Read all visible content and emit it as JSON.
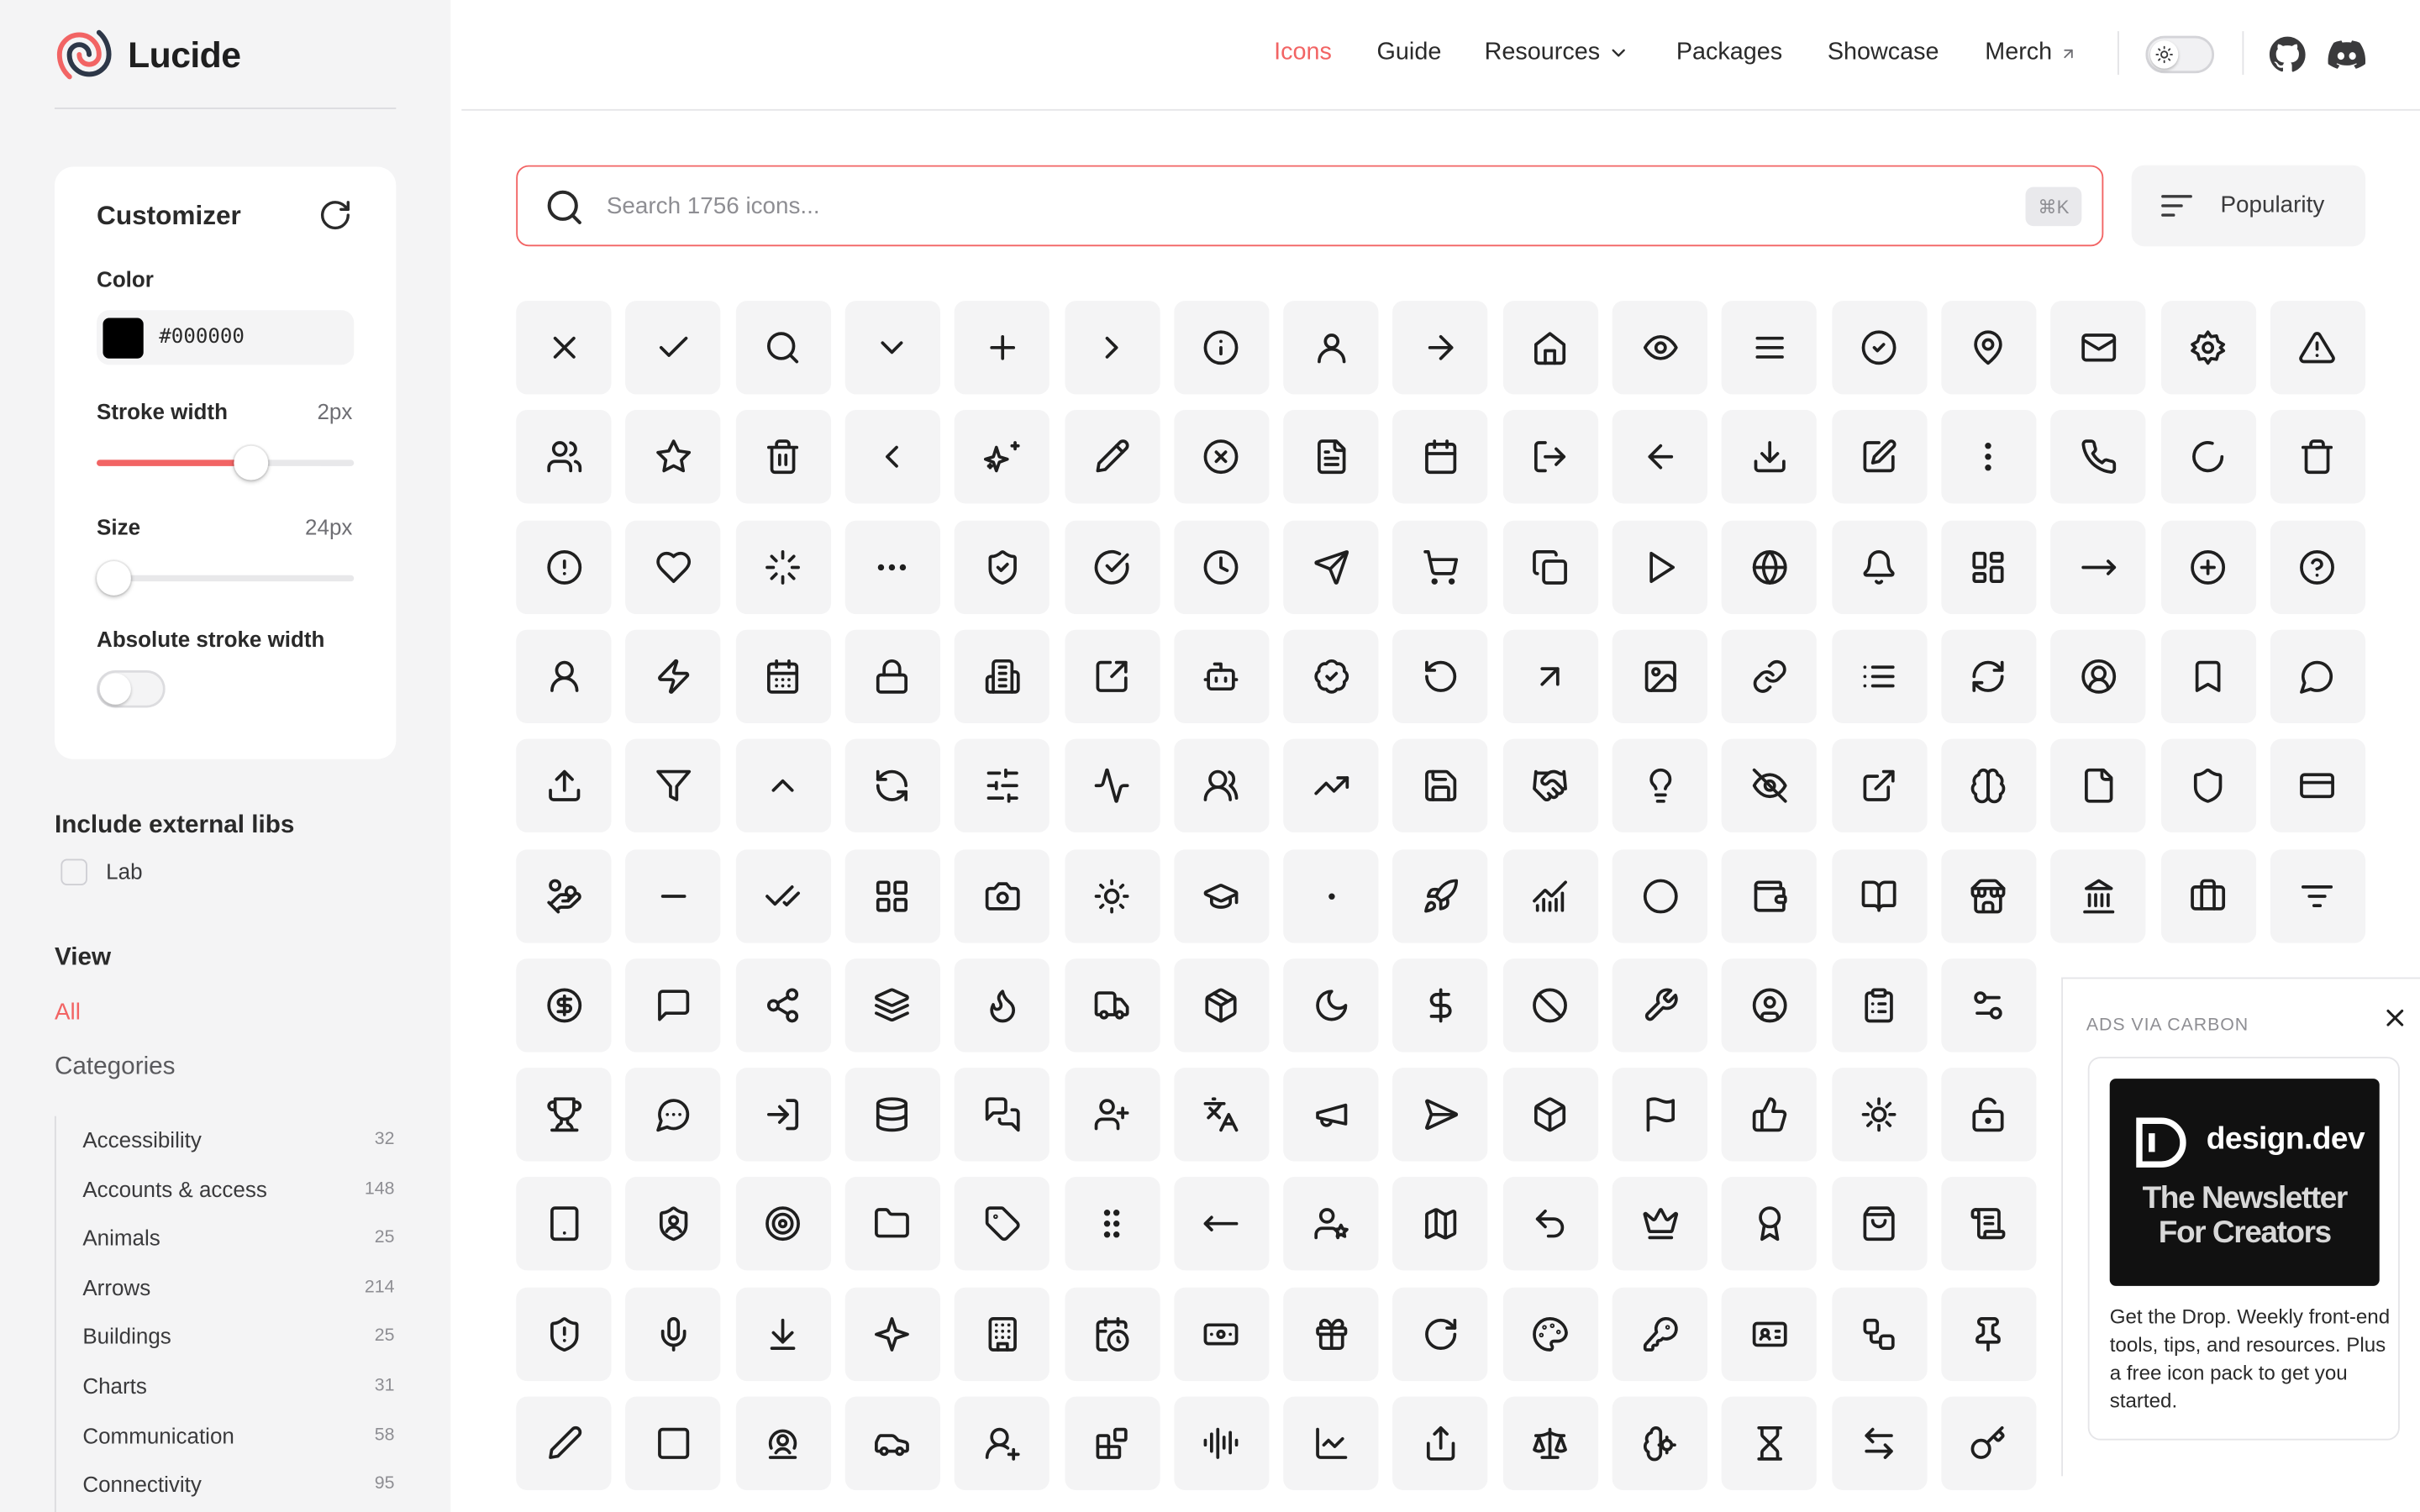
{
  "brand": {
    "name": "Lucide",
    "accent": "#f26464"
  },
  "nav": {
    "items": [
      {
        "label": "Icons",
        "active": true
      },
      {
        "label": "Guide"
      },
      {
        "label": "Resources",
        "dropdown": true
      },
      {
        "label": "Packages"
      },
      {
        "label": "Showcase"
      },
      {
        "label": "Merch",
        "external": true
      }
    ],
    "theme": "light",
    "social": [
      "github-icon",
      "discord-icon"
    ]
  },
  "customizer": {
    "title": "Customizer",
    "color_label": "Color",
    "color_value": "#000000",
    "stroke_label": "Stroke width",
    "stroke_value": "2px",
    "stroke_level": 0.6,
    "size_label": "Size",
    "size_value": "24px",
    "size_level": 0.0,
    "absolute_label": "Absolute stroke width",
    "absolute_on": false
  },
  "external": {
    "title": "Include external libs",
    "lab_label": "Lab",
    "lab_checked": false
  },
  "view": {
    "title": "View",
    "all_label": "All",
    "categories_label": "Categories",
    "categories": [
      {
        "name": "Accessibility",
        "count": "32"
      },
      {
        "name": "Accounts & access",
        "count": "148"
      },
      {
        "name": "Animals",
        "count": "25"
      },
      {
        "name": "Arrows",
        "count": "214"
      },
      {
        "name": "Buildings",
        "count": "25"
      },
      {
        "name": "Charts",
        "count": "31"
      },
      {
        "name": "Communication",
        "count": "58"
      },
      {
        "name": "Connectivity",
        "count": "95"
      }
    ]
  },
  "search": {
    "placeholder": "Search 1756 icons...",
    "shortcut": "⌘K"
  },
  "sort": {
    "label": "Popularity"
  },
  "icons": [
    [
      "x",
      "check",
      "search",
      "chevron-down",
      "plus",
      "chevron-right",
      "info",
      "user",
      "arrow-right",
      "house",
      "eye",
      "menu",
      "circle-check",
      "map-pin",
      "mail",
      "settings",
      "triangle-alert"
    ],
    [
      "users",
      "star",
      "trash-2",
      "chevron-left",
      "sparkles",
      "pencil",
      "circle-x",
      "file-text",
      "calendar",
      "log-out",
      "arrow-left",
      "download",
      "square-pen",
      "ellipsis-vertical",
      "phone",
      "loader-circle",
      "trash"
    ],
    [
      "circle-alert",
      "heart",
      "loader",
      "ellipsis",
      "shield-check",
      "circle-check-big",
      "clock",
      "send",
      "shopping-cart",
      "copy",
      "play",
      "globe",
      "bell",
      "layout-grid",
      "move-right",
      "circle-plus",
      "circle-help"
    ],
    [
      "user-round",
      "zap",
      "calendar-days",
      "lock",
      "building-2",
      "square-arrow-out-up-right",
      "bot",
      "badge-check",
      "rotate-ccw",
      "arrow-up-right",
      "image",
      "link",
      "list",
      "refresh-cw",
      "circle-user-round",
      "bookmark",
      "message-circle"
    ],
    [
      "upload",
      "funnel",
      "chevron-up",
      "refresh-ccw",
      "sliders-horizontal",
      "activity",
      "users-round",
      "trending-up",
      "save",
      "handshake",
      "lightbulb",
      "eye-off",
      "external-link",
      "brain",
      "file",
      "shield",
      "credit-card"
    ],
    [
      "hand-coins",
      "minus",
      "check-check",
      "layout-grid-2",
      "camera",
      "sun",
      "graduation-cap",
      "dot",
      "rocket",
      "chart-no-axes-combined",
      "circle",
      "wallet",
      "book-open",
      "store",
      "landmark",
      "briefcase",
      "list-filter"
    ],
    [
      "circle-dollar-sign",
      "message-square",
      "share-2",
      "layers",
      "flame",
      "truck",
      "package",
      "moon",
      "dollar-sign",
      "ban",
      "wrench",
      "circle-user",
      "clipboard-list",
      "sliders"
    ],
    [
      "trophy",
      "message-circle-more",
      "log-in",
      "database",
      "messages-square",
      "user-plus",
      "languages",
      "megaphone",
      "send-horizontal",
      "box",
      "flag",
      "thumbs-up",
      "cog",
      "lock-keyhole-open"
    ],
    [
      "tablet",
      "shield-user",
      "target",
      "folder",
      "tag",
      "grip-vertical",
      "move-left",
      "user-star",
      "map",
      "undo-2",
      "crown",
      "award",
      "shopping-bag",
      "scroll-text"
    ],
    [
      "shield-alert",
      "mic",
      "arrow-down-to-line",
      "sparkle",
      "building",
      "calendar-clock",
      "banknote",
      "gift",
      "rotate-cw",
      "palette",
      "key-round",
      "id-card",
      "workflow",
      "pin"
    ],
    [
      "pen",
      "square",
      "map-pin-user",
      "car",
      "user-round-plus",
      "blocks",
      "audio-lines",
      "chart-line",
      "share",
      "scale",
      "brain-cog",
      "hourglass",
      "arrow-left-right",
      "key"
    ]
  ],
  "ad": {
    "header": "ADS VIA CARBON",
    "brand": "design.dev",
    "tag1": "The Newsletter",
    "tag2": "For Creators",
    "text": "Get the Drop. Weekly front-end tools, tips, and resources. Plus a free icon pack to get you started."
  }
}
